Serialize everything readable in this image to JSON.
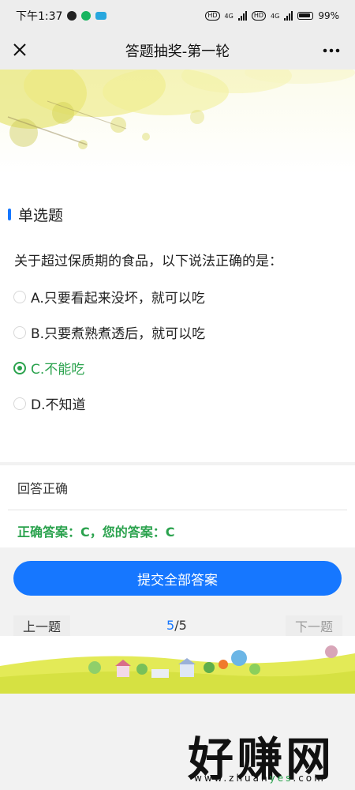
{
  "status_bar": {
    "time": "下午1:37",
    "network_a": "4G",
    "network_b": "4G",
    "battery_text": "99%"
  },
  "header": {
    "title": "答题抽奖-第一轮"
  },
  "question": {
    "type": "单选题",
    "text": "关于超过保质期的食品，以下说法正确的是：",
    "options": [
      {
        "label": "A.只要看起来没坏，就可以吃",
        "selected": false
      },
      {
        "label": "B.只要煮熟煮透后，就可以吃",
        "selected": false
      },
      {
        "label": "C.不能吃",
        "selected": true
      },
      {
        "label": "D.不知道",
        "selected": false
      }
    ]
  },
  "result": {
    "title": "回答正确",
    "detail": "正确答案：C，您的答案：C"
  },
  "actions": {
    "submit_label": "提交全部答案",
    "prev_label": "上一题",
    "next_label": "下一题",
    "current_page": "5",
    "page_separator": "/",
    "total_pages": "5"
  },
  "watermark": {
    "main": "好赚网",
    "site_pre": "www.zhuan",
    "site_accent": "yes",
    "site_post": ".com"
  },
  "colors": {
    "accent": "#1677ff",
    "success": "#2aa24d"
  },
  "icons": [
    "close-icon",
    "more-icon",
    "radio-icon",
    "signal-icon",
    "battery-icon"
  ]
}
